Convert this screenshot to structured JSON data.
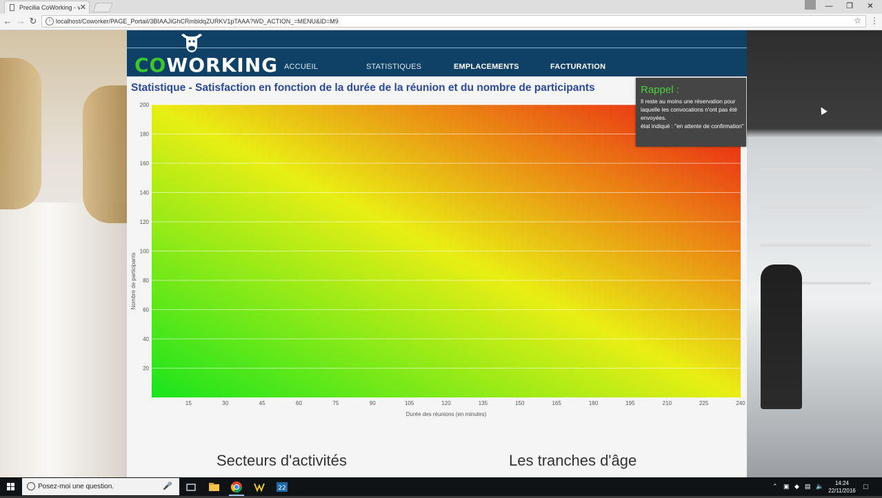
{
  "browser": {
    "tab_title": "Precilia CoWorking - vot",
    "tab_close": "✕",
    "url": "localhost/Coworker/PAGE_Portail/3BIAAJiGhCRmbldqZURKV1pTAAA?WD_ACTION_=MENU&ID=M9",
    "back_icon": "arrow-left",
    "forward_icon": "arrow-right",
    "reload_icon": "reload",
    "min": "—",
    "max": "❐",
    "close": "✕"
  },
  "app": {
    "logo_prefix": "CO",
    "logo_rest": "WORKING",
    "nav": [
      {
        "label": "ACCUEIL",
        "active": false
      },
      {
        "label": "STATISTIQUES",
        "active": false
      },
      {
        "label": "EMPLACEMENTS",
        "active": true
      },
      {
        "label": "FACTURATION",
        "active": true
      }
    ],
    "stat_title": "Statistique - Satisfaction en fonction de la durée de la réunion et du nombre de participants",
    "section_left": "Secteurs d'activités",
    "section_right": "Les tranches d'âge",
    "colors": {
      "header": "#0f4065",
      "green_logo": "#3cc72e",
      "title": "#2c4a9a"
    }
  },
  "popup": {
    "title": "Rappel :",
    "line1": "Il reste au moins une réservation pour laquelle les convocations n'ont pas été envoyées.",
    "line2": "état indiqué : \"en attente de confirmation\""
  },
  "chart_data": {
    "type": "heatmap",
    "title": "Statistique - Satisfaction en fonction de la durée de la réunion et du nombre de participants",
    "xlabel": "Durée des réunions (en minutes)",
    "ylabel": "Nombre de participants",
    "xticks": [
      15,
      30,
      45,
      60,
      75,
      90,
      105,
      120,
      135,
      150,
      165,
      180,
      195,
      210,
      225,
      240
    ],
    "yticks": [
      20,
      40,
      60,
      80,
      100,
      120,
      140,
      160,
      180,
      200
    ],
    "xlim": [
      0,
      240
    ],
    "ylim": [
      0,
      200
    ],
    "colorscale": [
      "#19e41c",
      "#e9ee14",
      "#ea1714"
    ],
    "grid": true
  },
  "taskbar": {
    "search_placeholder": "Posez-moi une question.",
    "time": "14:24",
    "date": "22/11/2016"
  }
}
